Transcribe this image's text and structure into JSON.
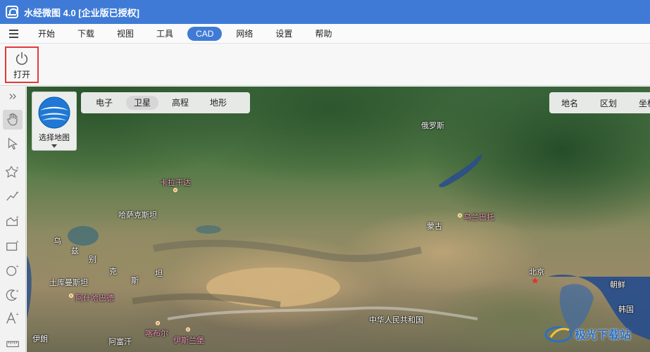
{
  "app": {
    "title": "水经微图 4.0 [企业版已授权]"
  },
  "menu": {
    "items": [
      {
        "label": "开始"
      },
      {
        "label": "下载"
      },
      {
        "label": "视图"
      },
      {
        "label": "工具"
      },
      {
        "label": "CAD",
        "active": true
      },
      {
        "label": "网络"
      },
      {
        "label": "设置"
      },
      {
        "label": "帮助"
      }
    ]
  },
  "ribbon": {
    "open_label": "打开"
  },
  "map": {
    "chooser_label": "选择地图",
    "types": [
      {
        "label": "电子"
      },
      {
        "label": "卫星",
        "active": true
      },
      {
        "label": "高程"
      },
      {
        "label": "地形"
      }
    ],
    "layers": [
      {
        "label": "地名"
      },
      {
        "label": "区划"
      },
      {
        "label": "坐标"
      }
    ],
    "labels": {
      "russia": "俄罗斯",
      "kazakhstan": "哈萨克斯坦",
      "mongolia": "蒙古",
      "china": "中华人民共和国",
      "beijing": "北京",
      "ulaanbaatar": "乌兰巴托",
      "karaganda": "卡拉干达",
      "uzbekistan_1": "乌",
      "uzbekistan_2": "兹",
      "uzbekistan_3": "别",
      "uzbekistan_4": "克",
      "uzbekistan_5": "斯",
      "uzbekistan_6": "坦",
      "turkmenistan": "土库曼斯坦",
      "ashgabat": "阿什哈巴德",
      "iran": "伊朗",
      "afghanistan": "阿富汗",
      "kabul": "喀布尔",
      "islamabad": "伊斯兰堡",
      "korea": "朝鲜",
      "south_korea": "韩国"
    },
    "colors": {
      "land_green": "#3e6a3e",
      "desert": "#c8aa78",
      "sea": "#2a4f8a",
      "poi_dot": "#f3a83a",
      "capital_star": "#e0302a"
    }
  },
  "watermark": {
    "text": "极光下载站"
  }
}
